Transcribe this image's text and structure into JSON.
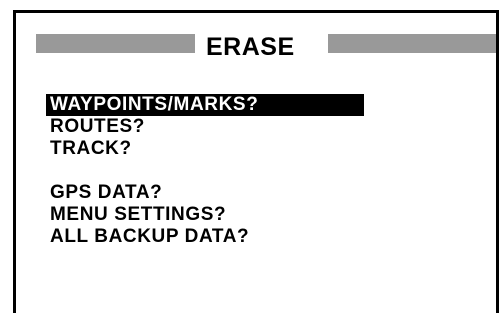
{
  "title": "ERASE",
  "menu": {
    "group1": [
      "WAYPOINTS/MARKS?",
      "ROUTES?",
      "TRACK?"
    ],
    "group2": [
      "GPS DATA?",
      "MENU SETTINGS?",
      "ALL BACKUP DATA?"
    ],
    "selected_label": "WAYPOINTS/MARKS?"
  },
  "colors": {
    "background": "#ffffff",
    "text": "#000000",
    "title_bar_fill": "#999999",
    "selection_background": "#000000",
    "selection_text": "#ffffff"
  }
}
